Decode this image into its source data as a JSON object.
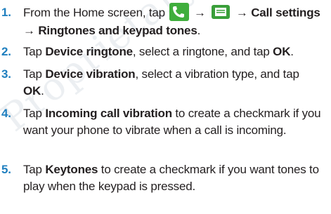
{
  "header_fragment": "",
  "icons": {
    "phone": "phone-icon",
    "menu": "menu-icon"
  },
  "colors": {
    "step_number": "#1f7fbf",
    "icon_bg": "#3fae3c"
  },
  "watermark": "Proprietary",
  "steps": [
    {
      "number": "1.",
      "from_text": "From the Home screen, tap ",
      "arrow": "→",
      "call_settings": "Call settings",
      "ringtones": "Ringtones and keypad tones",
      "period": "."
    },
    {
      "number": "2.",
      "tap": "Tap ",
      "device_ringtone": "Device ringtone",
      "mid": ", select a ringtone, and tap ",
      "ok": "OK",
      "period": "."
    },
    {
      "number": "3.",
      "tap": "Tap ",
      "device_vibration": "Device vibration",
      "mid": ", select a vibration type, and tap",
      "ok": "OK",
      "period": "."
    },
    {
      "number": "4.",
      "tap": "Tap ",
      "incoming": "Incoming call vibration",
      "rest": " to create a checkmark if you want your phone to vibrate when a call is incoming."
    },
    {
      "number": "5.",
      "tap": " Tap ",
      "keytones": "Keytones",
      "rest": " to create a checkmark if you want tones to play when the keypad is pressed."
    }
  ]
}
